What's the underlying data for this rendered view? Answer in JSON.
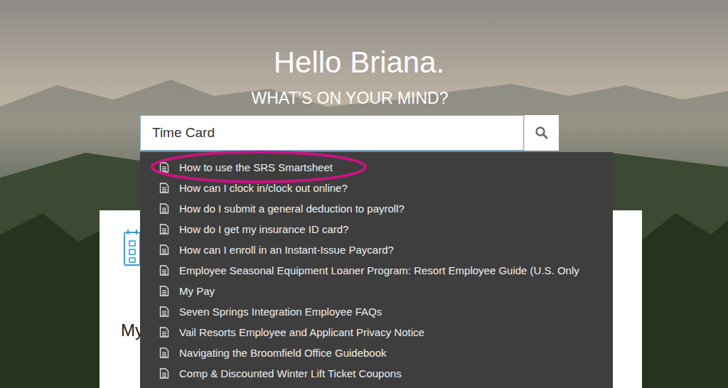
{
  "greeting": "Hello Briana.",
  "prompt": "WHAT'S ON YOUR MIND?",
  "search": {
    "value": "Time Card"
  },
  "suggestions": [
    {
      "label": "How to use the SRS Smartsheet",
      "circled": true
    },
    {
      "label": "How can I clock in/clock out online?",
      "circled": false
    },
    {
      "label": "How do I submit a general deduction to payroll?",
      "circled": false
    },
    {
      "label": "How do I get my insurance ID card?",
      "circled": false
    },
    {
      "label": "How can I enroll in an Instant-Issue Paycard?",
      "circled": false
    },
    {
      "label": "Employee Seasonal Equipment Loaner Program: Resort Employee Guide (U.S. Only",
      "circled": false
    },
    {
      "label": "My Pay",
      "circled": false
    },
    {
      "label": "Seven Springs Integration Employee FAQs",
      "circled": false
    },
    {
      "label": "Vail Resorts Employee and Applicant Privacy Notice",
      "circled": false
    },
    {
      "label": "Navigating the Broomfield Office Guidebook",
      "circled": false
    },
    {
      "label": "Comp & Discounted Winter Lift Ticket Coupons",
      "circled": false
    }
  ],
  "card": {
    "title": "My"
  }
}
